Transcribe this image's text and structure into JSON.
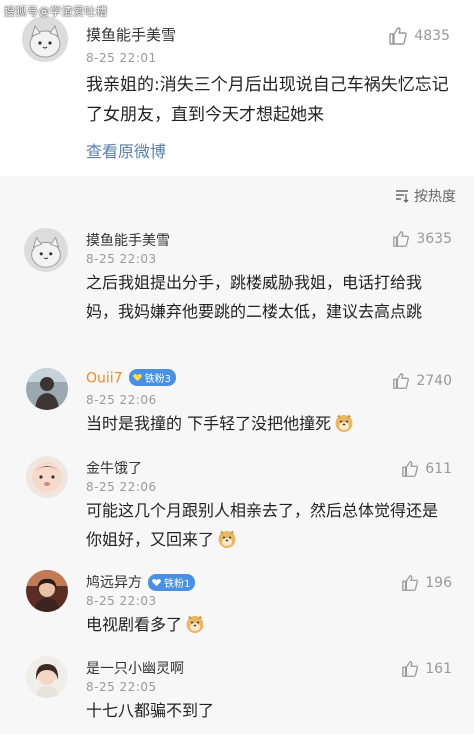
{
  "watermark": "搜狐号@学渣爱吐槽",
  "post": {
    "username": "摸鱼能手美雪",
    "time": "8-25 22:01",
    "likes": "4835",
    "text": "我亲姐的:消失三个月后出现说自己车祸失忆忘记了女朋友，直到今天才想起她来",
    "view_original": "查看原微博"
  },
  "sort": {
    "label": "按热度",
    "icon": "sort-icon"
  },
  "comments": [
    {
      "username": "摸鱼能手美雪",
      "time": "8-25 22:03",
      "likes": "3635",
      "text": "之后我姐提出分手，跳楼威胁我姐，电话打给我妈，我妈嫌弃他要跳的二楼太低，建议去高点跳",
      "badge": "",
      "emoji": false
    },
    {
      "username": "Ouii7",
      "time": "8-25 22:06",
      "likes": "2740",
      "text": "当时是我撞的 下手轻了没把他撞死",
      "badge": "铁粉3",
      "emoji": true
    },
    {
      "username": "金牛饿了",
      "time": "8-25 22:06",
      "likes": "611",
      "text": "可能这几个月跟别人相亲去了，然后总体觉得还是你姐好，又回来了",
      "badge": "",
      "emoji": true
    },
    {
      "username": "鸠远异方",
      "time": "8-25 22:03",
      "likes": "196",
      "text": "电视剧看多了",
      "badge": "铁粉1",
      "emoji": true
    },
    {
      "username": "是一只小幽灵啊",
      "time": "8-25 22:05",
      "likes": "161",
      "text": "十七八都骗不到了",
      "badge": "",
      "emoji": false
    }
  ],
  "colors": {
    "link": "#5b7fa8",
    "badge": "#4a90e2",
    "vip_name": "#f08a24",
    "meta": "#999999"
  }
}
